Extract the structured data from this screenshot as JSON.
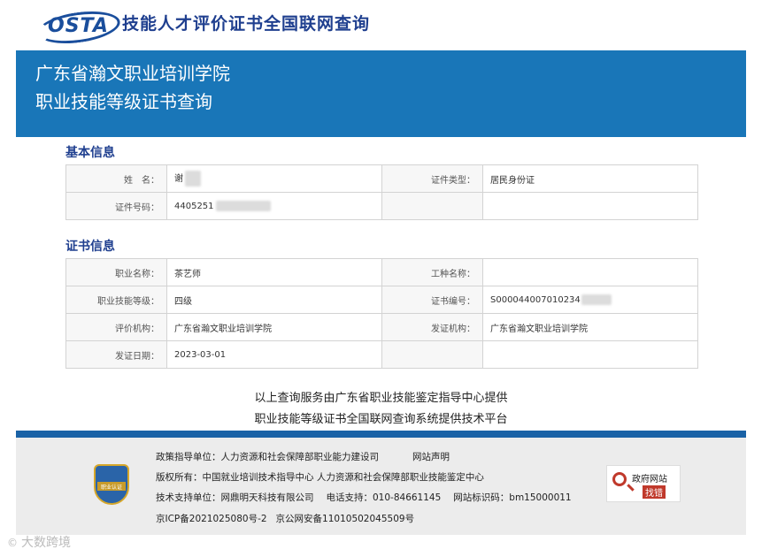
{
  "header": {
    "logo_text": "OSTA",
    "site_title": "技能人才评价证书全国联网查询"
  },
  "hero": {
    "org": "广东省瀚文职业培训学院",
    "title": "职业技能等级证书查询"
  },
  "basic": {
    "section_title": "基本信息",
    "name_label": "姓　名：",
    "name_value": "谢",
    "id_type_label": "证件类型：",
    "id_type_value": "居民身份证",
    "id_no_label": "证件号码：",
    "id_no_value": "4405251"
  },
  "cert": {
    "section_title": "证书信息",
    "occupation_label": "职业名称：",
    "occupation_value": "茶艺师",
    "work_type_label": "工种名称：",
    "work_type_value": "",
    "level_label": "职业技能等级：",
    "level_value": "四级",
    "cert_no_label": "证书编号：",
    "cert_no_value": "S000044007010234",
    "eval_org_label": "评价机构：",
    "eval_org_value": "广东省瀚文职业培训学院",
    "issue_org_label": "发证机构：",
    "issue_org_value": "广东省瀚文职业培训学院",
    "issue_date_label": "发证日期：",
    "issue_date_value": "2023-03-01"
  },
  "notice": {
    "line1": "以上查询服务由广东省职业技能鉴定指导中心提供",
    "line2": "职业技能等级证书全国联网查询系统提供技术平台"
  },
  "footer": {
    "policy": "政策指导单位：人力资源和社会保障部职业能力建设司",
    "statement": "网站声明",
    "copyright": "版权所有：中国就业培训技术指导中心 人力资源和社会保障部职业技能鉴定中心",
    "support": "技术支持单位：网鼎明天科技有限公司",
    "phone": "电话支持：010-84661145",
    "site_id": "网站标识码：bm15000011",
    "icp": "京ICP备2021025080号-2",
    "police": "京公网安备11010502045509号",
    "badge_text": "职业认证",
    "gov_title": "政府网站",
    "gov_sub": "找错"
  },
  "watermark": "大数跨境"
}
